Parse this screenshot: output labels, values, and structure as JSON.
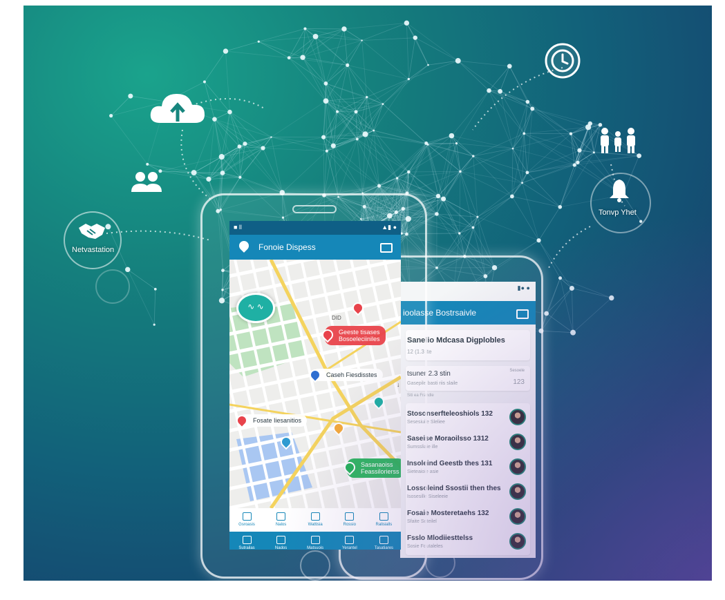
{
  "floating_icons": {
    "cloud_upload": "cloud-upload-icon",
    "clock": "clock-icon",
    "users_small": "users-icon",
    "family": "family-icon",
    "handshake": "handshake-icon",
    "handshake_label": "Netvastation",
    "bell": "bell-icon",
    "bell_label": "Tonvp Yhet"
  },
  "phone_map": {
    "status_left": "■ ll",
    "status_right": "▲▮ ●",
    "header_title": "Fonoie Dispess",
    "chat_bubble_text": "∿ ∿",
    "map_labels": [
      "DID",
      "↓"
    ],
    "pins": [
      {
        "text_line1": "Geeste tisases",
        "text_line2": "Bosoeleciiniles",
        "color": "#e8434b"
      },
      {
        "text_line1": "Caseh Fiesdisstes",
        "text_line2": "",
        "color": "#2f6fd1"
      },
      {
        "text_line1": "Fosate Iiesanitios",
        "text_line2": "",
        "color": "#e8434b"
      },
      {
        "text_line1": "Sasanaoiss",
        "text_line2": "Feassilorierss",
        "color": "#25b35a"
      }
    ],
    "nav_top": [
      "Gsroasis",
      "Nalos",
      "Wattisia",
      "Rossio",
      "Ralisialls"
    ],
    "nav_bottom": [
      "Sutrailas",
      "Nados",
      "Matsuois",
      "Yerantel",
      "Tasatiares"
    ]
  },
  "phone_list": {
    "status_right": "▮● ●",
    "header_title": "ioolasse Bostrsaivle",
    "card1_title": "Sanelio Mdcasa Digplobles",
    "card1_sub": "12 (1.3 ite",
    "card2_title": "tsuner 2.3 stin",
    "card2_sub": "Gasepile basti riis slaile",
    "card2_side_label": "Sesoele",
    "card2_side_value": "123",
    "section_label": "Siti ea Frandle",
    "rows": [
      {
        "name": "Stosonserfteleoshiols 132",
        "sub": "Sesesiuile Sleliee"
      },
      {
        "name": "Saseise Moraoilsso 1312",
        "sub": "Sumssliaie ille"
      },
      {
        "name": "Insoleind Geestb thes 131",
        "sub": "Sieteaioie asie"
      },
      {
        "name": "Lossoleind Ssostii then thes",
        "sub": "Isosesille Siseleeie"
      },
      {
        "name": "Fosaie Mosteretaehs 132",
        "sub": "Sfaite Soteilel"
      },
      {
        "name": "Fsslo Mlodiiesttelss",
        "sub": "Sosie Foutaleles"
      }
    ]
  },
  "colors": {
    "header_blue": "#1587b8",
    "status_blue": "#0f5f86",
    "map_road_yellow": "#f4d35e",
    "map_park_green": "#bfe3c0",
    "map_water_blue": "#a9c7f2"
  }
}
